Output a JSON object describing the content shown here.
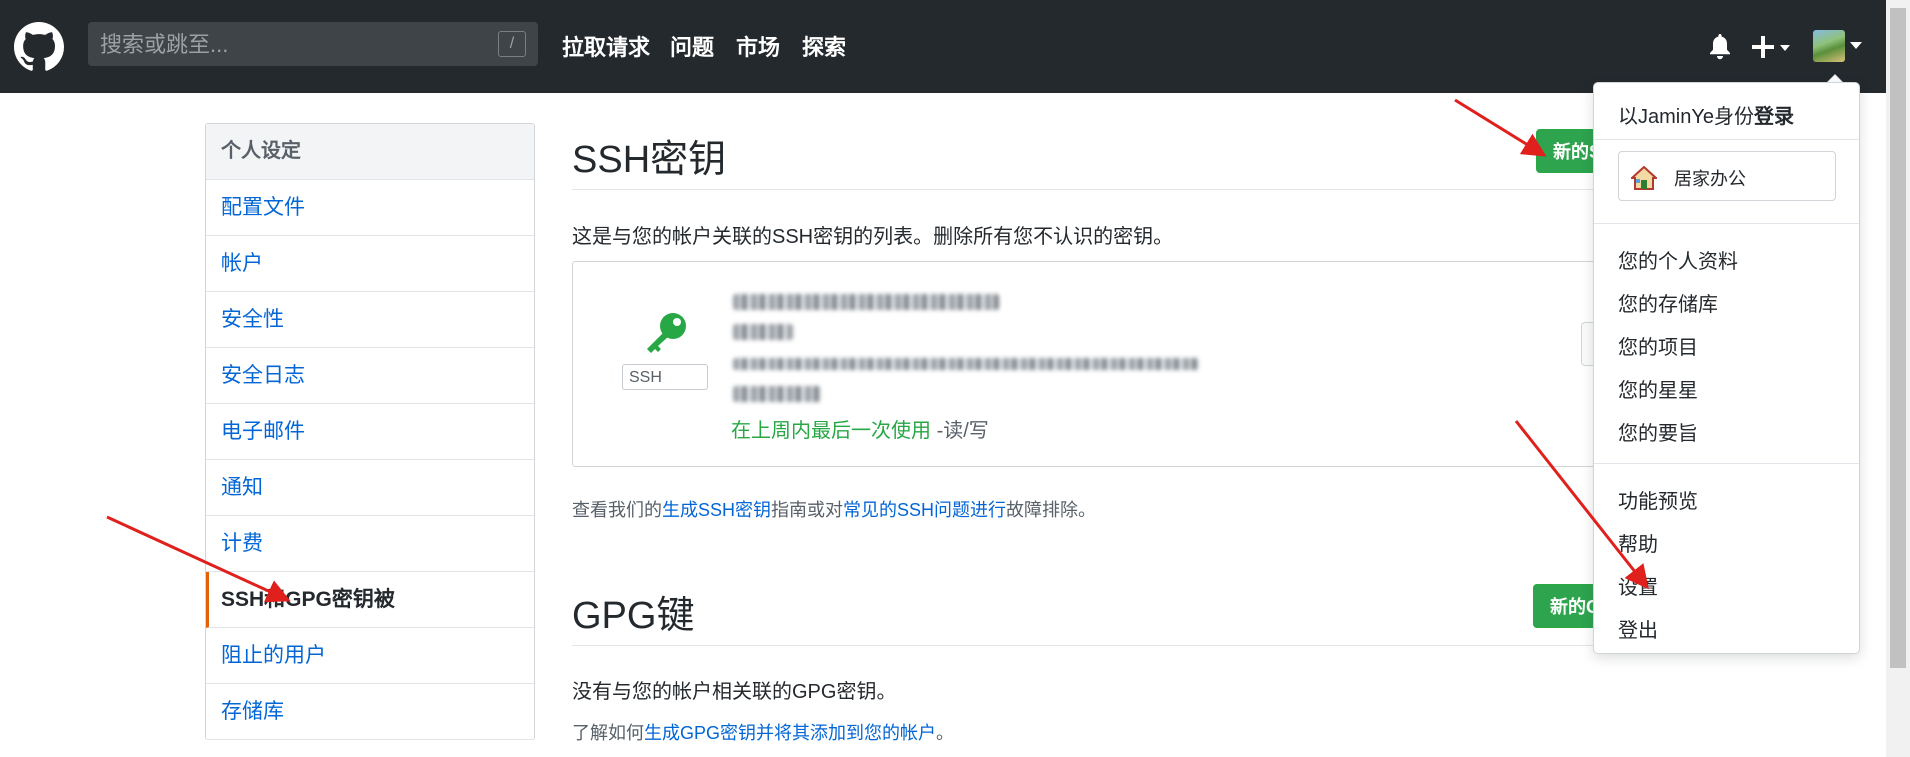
{
  "header": {
    "search_placeholder": "搜索或跳至...",
    "slash_hint": "/",
    "nav": [
      "拉取请求",
      "问题",
      "市场",
      "探索"
    ],
    "icons": [
      "github-logo",
      "bell-icon",
      "plus-icon",
      "avatar"
    ]
  },
  "sidebar": {
    "title": "个人设定",
    "items": [
      {
        "label": "配置文件"
      },
      {
        "label": "帐户"
      },
      {
        "label": "安全性"
      },
      {
        "label": "安全日志"
      },
      {
        "label": "电子邮件"
      },
      {
        "label": "通知"
      },
      {
        "label": "计费"
      },
      {
        "label": "SSH和GPG密钥被",
        "active": true
      },
      {
        "label": "阻止的用户"
      },
      {
        "label": "存储库"
      }
    ]
  },
  "ssh": {
    "title": "SSH密钥",
    "new_button": "新的SSH密钥",
    "description": "这是与您的帐户关联的SSH密钥的列表。删除所有您不认识的密钥。",
    "key_badge": "SSH",
    "key_used": "在上周内最后一次使用",
    "key_access": "-读/写",
    "help_prefix": "查看我们的",
    "help_link1": "生成SSH密钥",
    "help_middle": "指南或对",
    "help_link2": "常见的SSH问题进行",
    "help_suffix": "故障排除。"
  },
  "gpg": {
    "title": "GPG键",
    "new_button": "新的GPG密钥",
    "description": "没有与您的帐户相关联的GPG密钥。",
    "learn_prefix": "了解如何",
    "learn_link": "生成GPG密钥并将其添加到您的帐户",
    "learn_suffix": "。"
  },
  "dropdown": {
    "signed_prefix": "以JaminYe身份",
    "signed_bold": "登录",
    "status": "居家办公",
    "group1": [
      "您的个人资料",
      "您的存储库",
      "您的项目",
      "您的星星",
      "您的要旨"
    ],
    "group2": [
      "功能预览",
      "帮助",
      "设置",
      "登出"
    ]
  },
  "colors": {
    "header_bg": "#24292e",
    "link": "#0366d6",
    "green": "#2ea44f",
    "active_marker": "#e36209",
    "annotation_arrow": "#e0201c"
  }
}
